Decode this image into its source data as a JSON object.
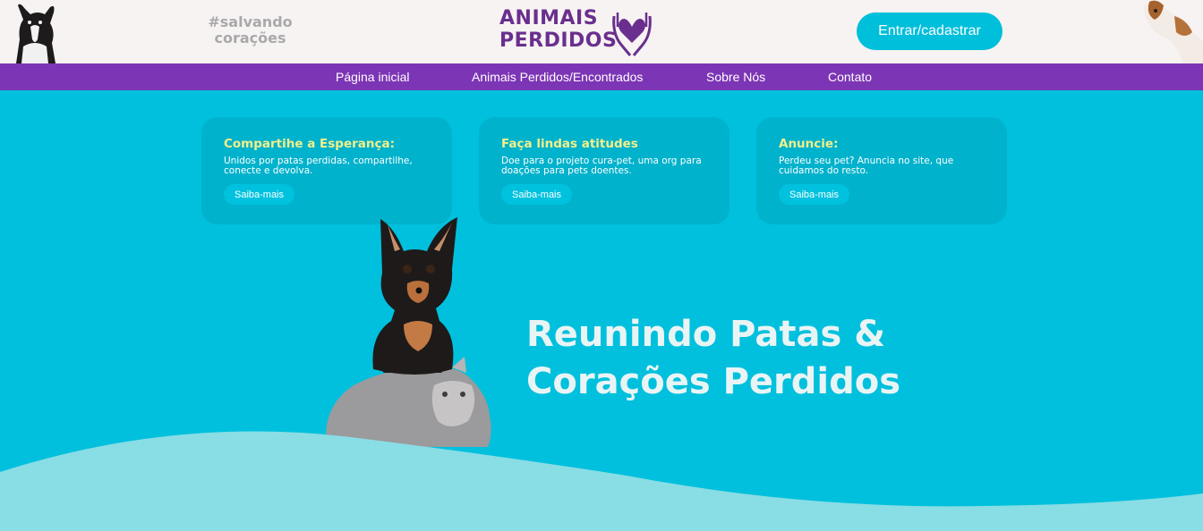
{
  "header": {
    "tagline": [
      "#salvando",
      "corações"
    ],
    "logo": {
      "line1": "ANIMAIS",
      "line2": "PERDIDOS"
    },
    "login_label": "Entrar/cadastrar"
  },
  "nav": {
    "items": [
      {
        "label": "Página inicial"
      },
      {
        "label": "Animais Perdidos/Encontrados"
      },
      {
        "label": "Sobre Nós"
      },
      {
        "label": "Contato"
      }
    ]
  },
  "cards": [
    {
      "title": "Compartihe a Esperança:",
      "text": "Unidos por patas perdidas, compartilhe, conecte e devolva.",
      "button": "Saiba-mais"
    },
    {
      "title": "Faça lindas atitudes",
      "text": "Doe para o projeto cura-pet, uma org para doações para pets doentes.",
      "button": "Saiba-mais"
    },
    {
      "title": "Anuncie:",
      "text": "Perdeu seu pet? Anuncia no site, que cuidamos do resto.",
      "button": "Saiba-mais"
    }
  ],
  "hero": {
    "title": [
      "Reunindo Patas &",
      "Corações Perdidos"
    ]
  },
  "colors": {
    "brand_purple": "#6a2f8e",
    "nav_purple": "#7c35b5",
    "accent_cyan": "#00c0dd",
    "card_title_yellow": "#f2f08a"
  }
}
